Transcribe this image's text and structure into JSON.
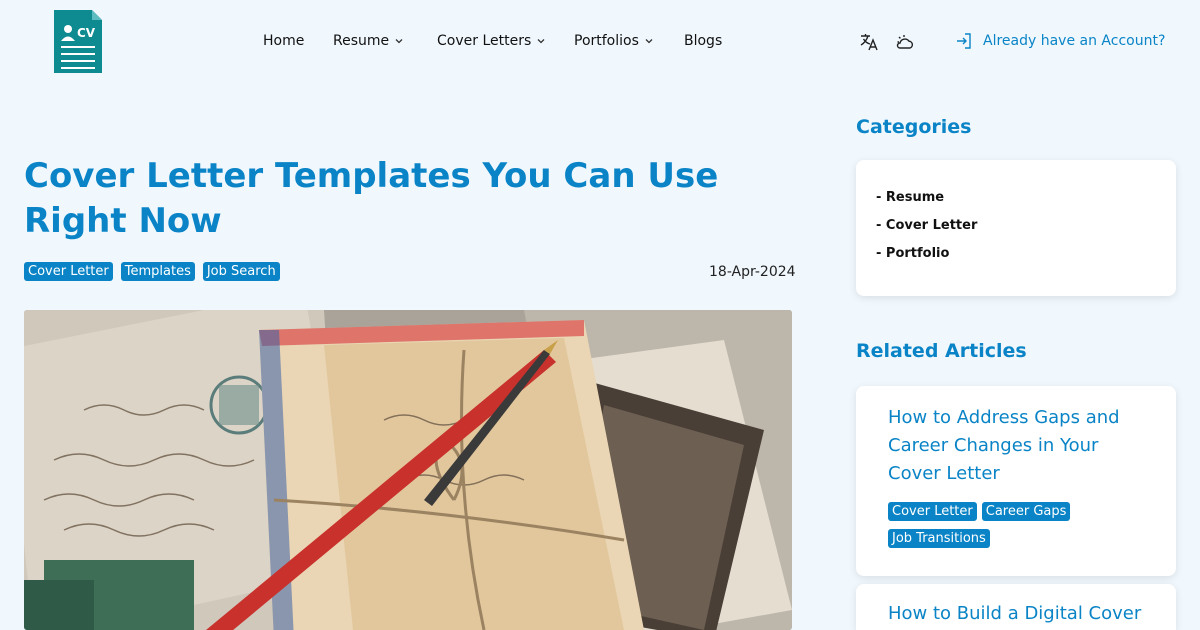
{
  "header": {
    "logo_text": "CV",
    "nav": [
      {
        "label": "Home"
      },
      {
        "label": "Resume"
      },
      {
        "label": "Cover Letters"
      },
      {
        "label": "Portfolios"
      },
      {
        "label": "Blogs"
      }
    ],
    "account_label": "Already have an Account?"
  },
  "article": {
    "title": "Cover Letter Templates You Can Use Right Now",
    "tags": [
      "Cover Letter",
      "Templates",
      "Job Search"
    ],
    "date": "18-Apr-2024"
  },
  "sidebar": {
    "categories_heading": "Categories",
    "categories": [
      "- Resume",
      "- Cover Letter",
      "- Portfolio"
    ],
    "related_heading": "Related Articles",
    "related": [
      {
        "title": "How to Address Gaps and Career Changes in Your Cover Letter",
        "tags": [
          "Cover Letter",
          "Career Gaps",
          "Job Transitions"
        ]
      },
      {
        "title": "How to Build a Digital Cover"
      }
    ]
  },
  "colors": {
    "accent": "#0a84c6",
    "background": "#f0f8fe",
    "logo": "#0e8a91"
  }
}
